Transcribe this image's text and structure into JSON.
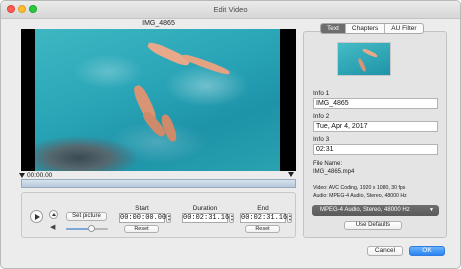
{
  "window": {
    "title": "Edit Video"
  },
  "clip": {
    "title": "IMG_4865"
  },
  "timeline": {
    "current_time": "00:00.00"
  },
  "controls": {
    "set_picture_label": "Set picture",
    "volume_level": 0.6,
    "start": {
      "label": "Start",
      "value": "00:00:00.00",
      "reset_label": "Reset"
    },
    "duration": {
      "label": "Duration",
      "value": "00:02:31.16"
    },
    "end": {
      "label": "End",
      "value": "00:02:31.16",
      "reset_label": "Reset"
    }
  },
  "panel": {
    "tabs": [
      {
        "label": "Text",
        "active": true
      },
      {
        "label": "Chapters",
        "active": false
      },
      {
        "label": "AU Filter",
        "active": false
      }
    ],
    "info1": {
      "label": "Info 1",
      "value": "IMG_4865"
    },
    "info2": {
      "label": "Info 2",
      "value": "Tue, Apr 4, 2017"
    },
    "info3": {
      "label": "Info 3",
      "value": "02:31"
    },
    "file_name_label": "File Name:",
    "file_name_value": "IMG_4865.mp4",
    "video_info": "Video: AVC Coding, 1920 x 1080, 30 fps",
    "audio_info": "Audio: MPEG-4 Audio, Stereo, 48000 Hz",
    "audio_format_selected": "MPEG-4 Audio, Stereo, 48000 Hz",
    "use_defaults_label": "Use Defaults"
  },
  "footer": {
    "cancel_label": "Cancel",
    "ok_label": "OK"
  },
  "colors": {
    "accent": "#2a84f0",
    "selected_tab": "#6d6d6d",
    "water": "#2aa6b8"
  }
}
